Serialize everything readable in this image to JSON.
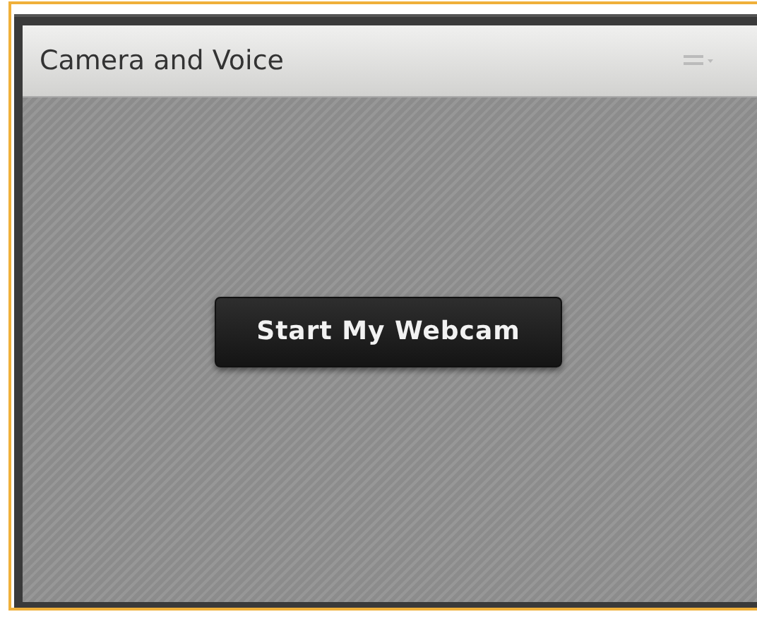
{
  "panel": {
    "title": "Camera and Voice"
  },
  "button": {
    "label": "Start My Webcam"
  }
}
